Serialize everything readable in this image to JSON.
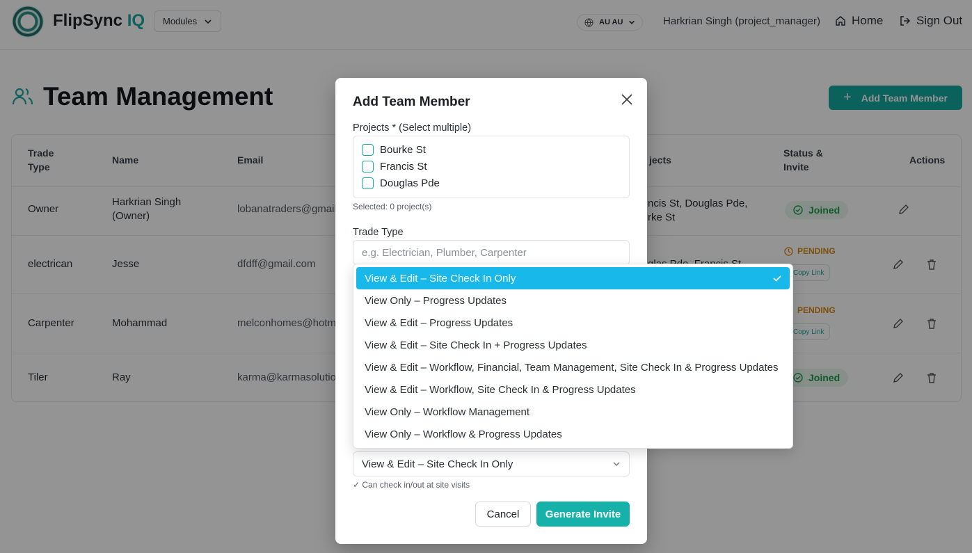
{
  "header": {
    "brand_main": "FlipSync",
    "brand_accent": "IQ",
    "modules_label": "Modules",
    "locale_label": "AU AU",
    "user_label": "Harkrian Singh (project_manager)",
    "home_label": "Home",
    "signout_label": "Sign Out"
  },
  "page": {
    "title": "Team Management",
    "add_button_label": "Add Team Member"
  },
  "table": {
    "columns": [
      "Trade Type",
      "Name",
      "Email",
      "Projects",
      "Status & Invite",
      "Actions"
    ],
    "columns_display": {
      "trade_type": "Trade\nType",
      "name": "Name",
      "email": "Email",
      "projects": "jects",
      "status": "Status &\nInvite",
      "actions": "Actions"
    },
    "rows": [
      {
        "trade": "Owner",
        "name": "Harkrian Singh (Owner)",
        "email": "lobanatraders@gmail",
        "projects": "ncis St, Douglas Pde,\nrke St",
        "status": "Joined"
      },
      {
        "trade": "electrican",
        "name": "Jesse",
        "email": "dfdff@gmail.com",
        "projects": "glas Pde, Francis St",
        "status": "PENDING",
        "copy_link": "Copy Link"
      },
      {
        "trade": "Carpenter",
        "name": "Mohammad",
        "email": "melconhomes@hotm",
        "projects": "",
        "status": "PENDING",
        "copy_link": "Copy Link"
      },
      {
        "trade": "Tiler",
        "name": "Ray",
        "email": "karma@karmasolutio",
        "projects": "",
        "status": "Joined"
      }
    ]
  },
  "modal": {
    "title": "Add Team Member",
    "projects_label": "Projects * (Select multiple)",
    "projects": [
      "Bourke St",
      "Francis St",
      "Douglas Pde"
    ],
    "selected_count": "Selected: 0 project(s)",
    "trade_label": "Trade Type",
    "trade_placeholder": "e.g. Electrician, Plumber, Carpenter",
    "permission_value": "View & Edit – Site Check In Only",
    "permission_hint": "✓ Can check in/out at site visits",
    "cancel_label": "Cancel",
    "generate_label": "Generate Invite"
  },
  "dropdown": {
    "options": [
      "View & Edit – Site Check In Only",
      "View Only – Progress Updates",
      "View & Edit – Progress Updates",
      "View & Edit – Site Check In + Progress Updates",
      "View & Edit – Workflow, Financial, Team Management, Site Check In & Progress Updates",
      "View & Edit – Workflow, Site Check In & Progress Updates",
      "View Only – Workflow Management",
      "View Only – Workflow & Progress Updates"
    ],
    "selected_index": 0
  },
  "colors": {
    "accent": "#16b2aa",
    "highlight": "#19b8ea",
    "joined": "#1d9a4a",
    "pending": "#d98a12"
  }
}
